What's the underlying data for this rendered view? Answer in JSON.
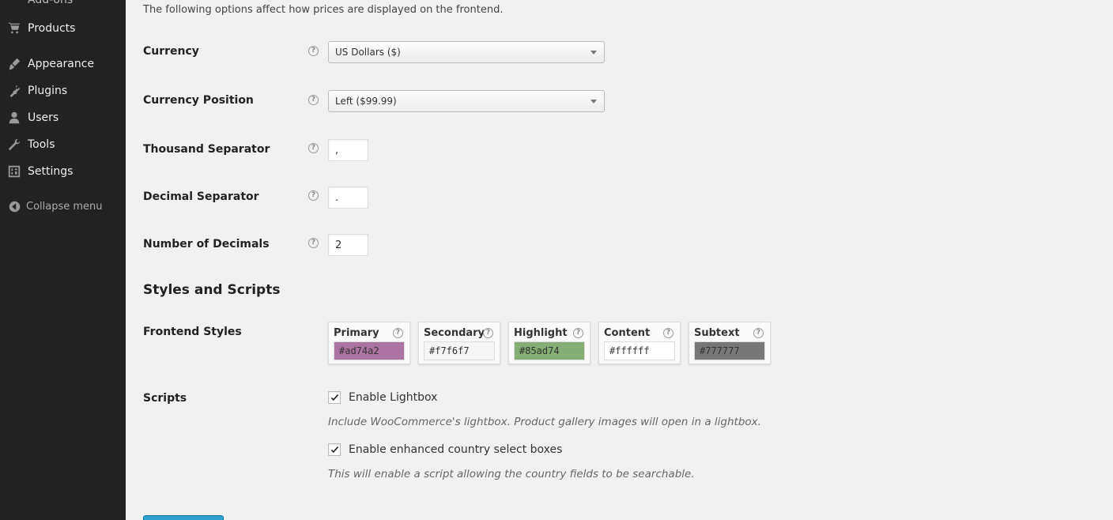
{
  "sidebar": {
    "partial_item": "Add-ons",
    "items": [
      {
        "label": "Products",
        "icon": "cart-icon"
      },
      {
        "label": "Appearance",
        "icon": "brush-icon"
      },
      {
        "label": "Plugins",
        "icon": "plug-icon"
      },
      {
        "label": "Users",
        "icon": "user-icon"
      },
      {
        "label": "Tools",
        "icon": "wrench-icon"
      },
      {
        "label": "Settings",
        "icon": "settings-icon"
      }
    ],
    "collapse_label": "Collapse menu"
  },
  "main": {
    "intro": "The following options affect how prices are displayed on the frontend.",
    "fields": {
      "currency": {
        "label": "Currency",
        "value": "US Dollars ($)"
      },
      "currency_position": {
        "label": "Currency Position",
        "value": "Left ($99.99)"
      },
      "thousand_separator": {
        "label": "Thousand Separator",
        "value": ","
      },
      "decimal_separator": {
        "label": "Decimal Separator",
        "value": "."
      },
      "number_of_decimals": {
        "label": "Number of Decimals",
        "value": "2"
      }
    },
    "help_glyph": "?",
    "styles_heading": "Styles and Scripts",
    "frontend_styles": {
      "label": "Frontend Styles",
      "colors": [
        {
          "label": "Primary",
          "value": "#ad74a2",
          "bg": "#ad74a2"
        },
        {
          "label": "Secondary",
          "value": "#f7f6f7",
          "bg": "#f7f6f7"
        },
        {
          "label": "Highlight",
          "value": "#85ad74",
          "bg": "#85ad74"
        },
        {
          "label": "Content",
          "value": "#ffffff",
          "bg": "#ffffff"
        },
        {
          "label": "Subtext",
          "value": "#777777",
          "bg": "#777777"
        }
      ]
    },
    "scripts": {
      "label": "Scripts",
      "lightbox": {
        "label": "Enable Lightbox",
        "checked": true,
        "description": "Include WooCommerce's lightbox. Product gallery images will open in a lightbox."
      },
      "country_select": {
        "label": "Enable enhanced country select boxes",
        "checked": true,
        "description": "This will enable a script allowing the country fields to be searchable."
      }
    }
  }
}
